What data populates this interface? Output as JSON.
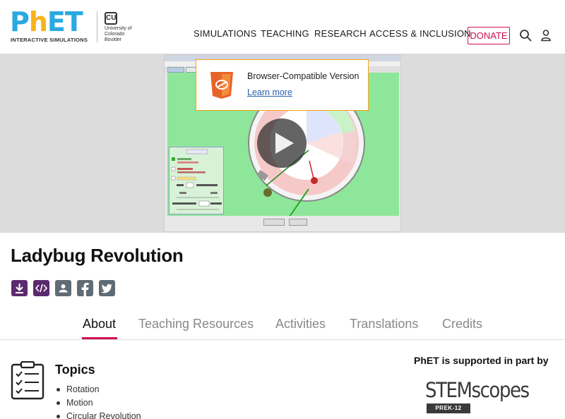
{
  "brand": {
    "logo_text": "PhET",
    "logo_subtitle": "INTERACTIVE SIMULATIONS",
    "university": "University of Colorado Boulder",
    "colors": {
      "blue": "#2aa9e0",
      "yellow": "#f7b31b",
      "accent": "#d0104c",
      "share_purple": "#5b2a6e"
    }
  },
  "nav": {
    "items": [
      "SIMULATIONS",
      "TEACHING",
      "RESEARCH",
      "ACCESS & INCLUSION"
    ],
    "donate_label": "DONATE",
    "search_icon": "search-icon",
    "account_icon": "user-icon"
  },
  "hero": {
    "notice_title": "Browser-Compatible Version",
    "notice_link": "Learn more",
    "notice_icon": "html5-icon",
    "play_icon": "play-icon"
  },
  "sim": {
    "title": "Ladybug Revolution",
    "share_icons": [
      "download-icon",
      "embed-icon",
      "classroom-icon",
      "facebook-icon",
      "twitter-icon"
    ]
  },
  "tabs": {
    "items": [
      "About",
      "Teaching Resources",
      "Activities",
      "Translations",
      "Credits"
    ],
    "active": "About"
  },
  "topics": {
    "heading": "Topics",
    "items": [
      "Rotation",
      "Motion",
      "Circular Revolution"
    ],
    "icon": "checklist-icon"
  },
  "support": {
    "heading": "PhET is supported in part by",
    "sponsor": "STEMscopes",
    "sponsor_badge": "PREK-12"
  }
}
